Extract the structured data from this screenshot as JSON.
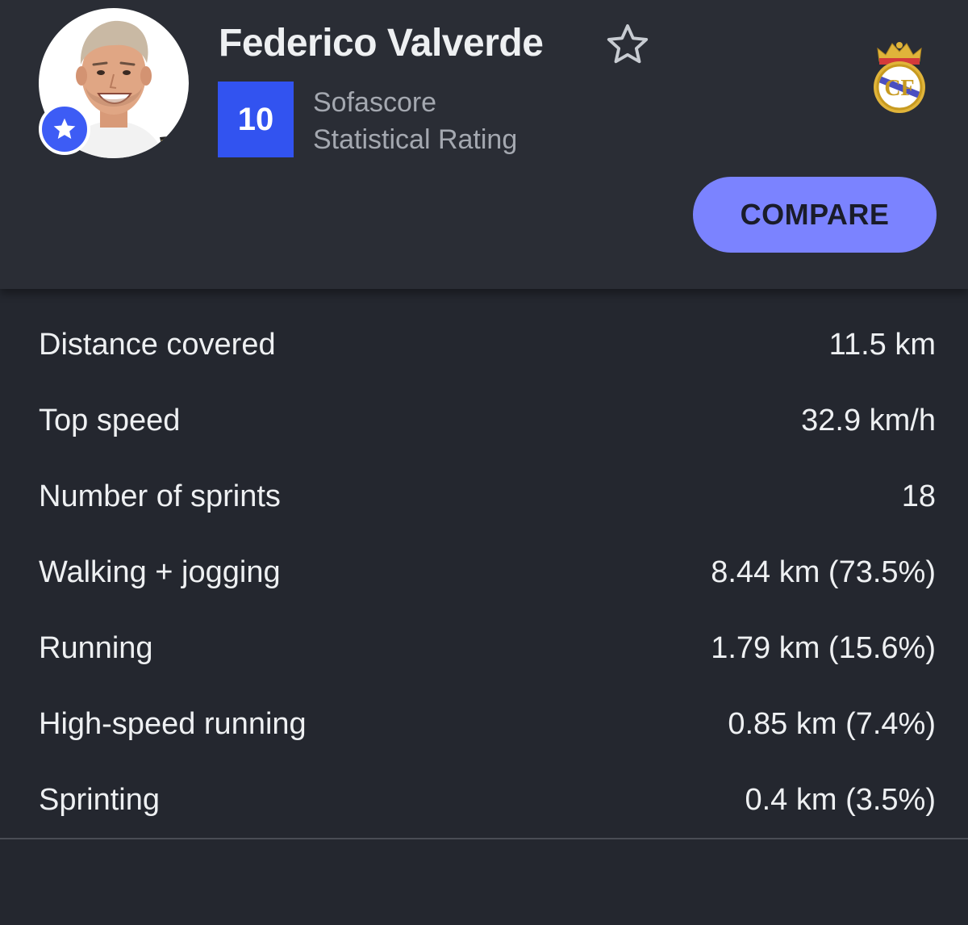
{
  "player": {
    "name": "Federico Valverde",
    "rating": "10",
    "rating_label_line1": "Sofascore",
    "rating_label_line2": "Statistical Rating"
  },
  "actions": {
    "compare_label": "COMPARE"
  },
  "icons": {
    "favorite": "star-outline-icon",
    "badge": "star-badge-icon",
    "club": "real-madrid-crest"
  },
  "colors": {
    "rating_bg": "#3253f0",
    "compare_bg": "#7b83ff",
    "badge_bg": "#3d5cf5",
    "background": "#24272f"
  },
  "stats": [
    {
      "label": "Distance covered",
      "value": "11.5 km"
    },
    {
      "label": "Top speed",
      "value": "32.9 km/h"
    },
    {
      "label": "Number of sprints",
      "value": "18"
    },
    {
      "label": "Walking + jogging",
      "value": "8.44 km (73.5%)"
    },
    {
      "label": "Running",
      "value": "1.79 km (15.6%)"
    },
    {
      "label": "High-speed running",
      "value": "0.85 km (7.4%)"
    },
    {
      "label": "Sprinting",
      "value": "0.4 km (3.5%)"
    }
  ]
}
